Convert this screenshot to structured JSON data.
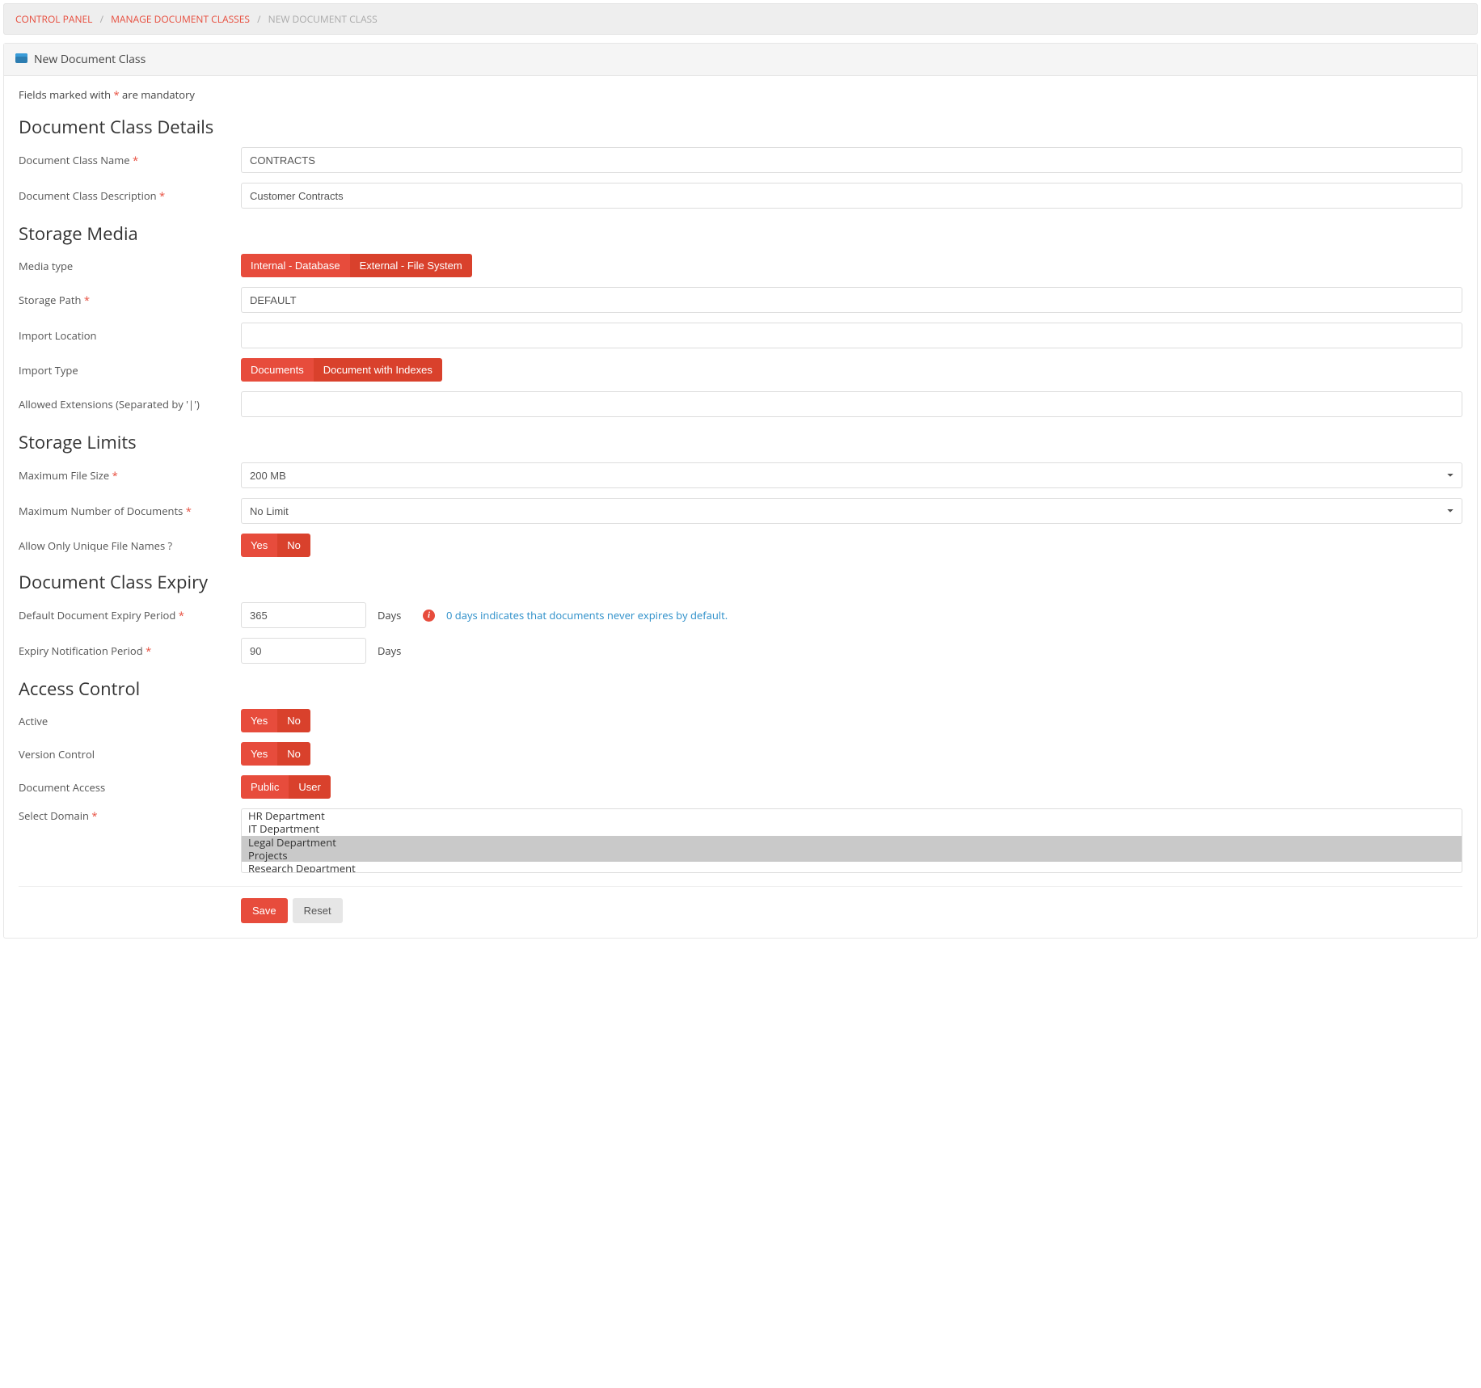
{
  "breadcrumb": {
    "items": [
      "CONTROL PANEL",
      "MANAGE DOCUMENT CLASSES"
    ],
    "current": "NEW DOCUMENT CLASS"
  },
  "panel_title": "New Document Class",
  "mandatory_note_prefix": "Fields marked with ",
  "mandatory_star": "*",
  "mandatory_note_suffix": " are mandatory",
  "sections": {
    "details": "Document Class Details",
    "storage_media": "Storage Media",
    "storage_limits": "Storage Limits",
    "expiry": "Document Class Expiry",
    "access": "Access Control"
  },
  "labels": {
    "name": "Document Class Name",
    "description": "Document Class Description",
    "media_type": "Media type",
    "storage_path": "Storage Path",
    "import_location": "Import Location",
    "import_type": "Import Type",
    "allowed_ext": "Allowed Extensions (Separated by '|')",
    "max_file_size": "Maximum File Size",
    "max_docs": "Maximum Number of Documents",
    "unique_names": "Allow Only Unique File Names ?",
    "default_expiry": "Default Document Expiry Period",
    "expiry_notif": "Expiry Notification Period",
    "active": "Active",
    "version_control": "Version Control",
    "document_access": "Document Access",
    "select_domain": "Select Domain"
  },
  "values": {
    "name": "CONTRACTS",
    "description": "Customer Contracts",
    "storage_path": "DEFAULT",
    "import_location": "",
    "allowed_ext": "",
    "max_file_size": "200 MB",
    "max_docs": "No Limit",
    "default_expiry": "365",
    "expiry_notif": "90"
  },
  "toggles": {
    "media_type": {
      "options": [
        "Internal - Database",
        "External - File System"
      ],
      "active_index": 0
    },
    "import_type": {
      "options": [
        "Documents",
        "Document with Indexes"
      ],
      "active_index": 0
    },
    "unique_names": {
      "options": [
        "Yes",
        "No"
      ],
      "active_index": 0
    },
    "active": {
      "options": [
        "Yes",
        "No"
      ],
      "active_index": 0
    },
    "version_control": {
      "options": [
        "Yes",
        "No"
      ],
      "active_index": 0
    },
    "document_access": {
      "options": [
        "Public",
        "User"
      ],
      "active_index": 0
    }
  },
  "suffix": {
    "days": "Days"
  },
  "expiry_hint": "0 days indicates that documents never expires by default.",
  "domain_options": [
    {
      "label": "HR Department",
      "selected": false
    },
    {
      "label": "IT Department",
      "selected": false
    },
    {
      "label": "Legal Department",
      "selected": true
    },
    {
      "label": "Projects",
      "selected": true
    },
    {
      "label": "Research Department",
      "selected": false
    }
  ],
  "buttons": {
    "save": "Save",
    "reset": "Reset"
  }
}
